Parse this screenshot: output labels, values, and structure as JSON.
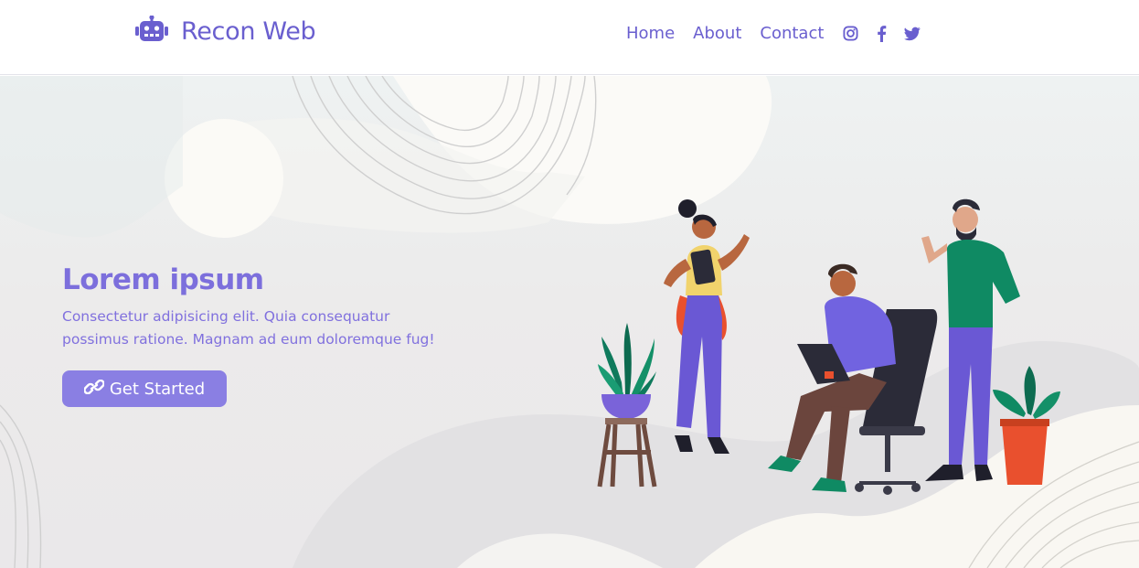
{
  "brand": {
    "title": "Recon Web",
    "logo_icon": "robot-icon"
  },
  "nav": {
    "links": [
      {
        "label": "Home"
      },
      {
        "label": "About"
      },
      {
        "label": "Contact"
      }
    ],
    "social": [
      "instagram-icon",
      "facebook-icon",
      "twitter-icon"
    ]
  },
  "hero": {
    "title": "Lorem ipsum",
    "description_line1": "Consectetur adipisicing elit. Quia consequatur",
    "description_line2": "possimus ratione. Magnam ad eum doloremque fug!",
    "cta_label": "Get Started",
    "cta_icon": "link-icon"
  },
  "colors": {
    "accent": "#6a5fcf",
    "button": "#8a7fe3",
    "background": "#eceeee"
  }
}
